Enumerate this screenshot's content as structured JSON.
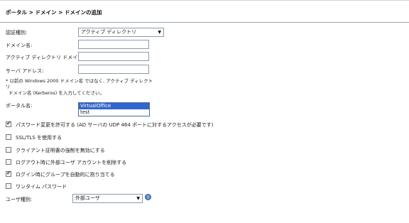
{
  "breadcrumb": "ポータル > ドメイン > ドメインの追加",
  "fields": {
    "auth_type_label": "認証種別:",
    "auth_type_value": "アクティブ ディレクトリ",
    "domain_name_label": "ドメイン名:",
    "ad_domain_label": "アクティブ ディレクトリ ドメイン名:",
    "server_address_label": "サーバ アドレス:"
  },
  "note": {
    "line1": "* 以前の Windows 2000 ドメイン名 ではなく, アクティブ ディレクト",
    "line2": "リ",
    "line3": "ドメイン名 (Kerberos) を入力してください。"
  },
  "portal": {
    "label": "ポータル名:",
    "options": [
      "VirtualOffice",
      "test"
    ],
    "selected_index": 0
  },
  "checkboxes": [
    {
      "label": "パスワード変更を許可する (AD サーバの UDP 464 ポートに対するアクセスが必要です)",
      "checked": true
    },
    {
      "label": "SSL/TLS を使用する",
      "checked": false
    },
    {
      "label": "クライアント証明書の強制を無効にする",
      "checked": false
    },
    {
      "label": "ログアウト時に外部ユーザ アカウントを削除する",
      "checked": false
    },
    {
      "label": "ログイン時にグループを自動的に割り当てる",
      "checked": true
    },
    {
      "label": "ワンタイム パスワード",
      "checked": false
    }
  ],
  "user_type": {
    "label": "ユーザ種別:",
    "value": "外部ユーザ",
    "help_icon": "help-icon"
  }
}
